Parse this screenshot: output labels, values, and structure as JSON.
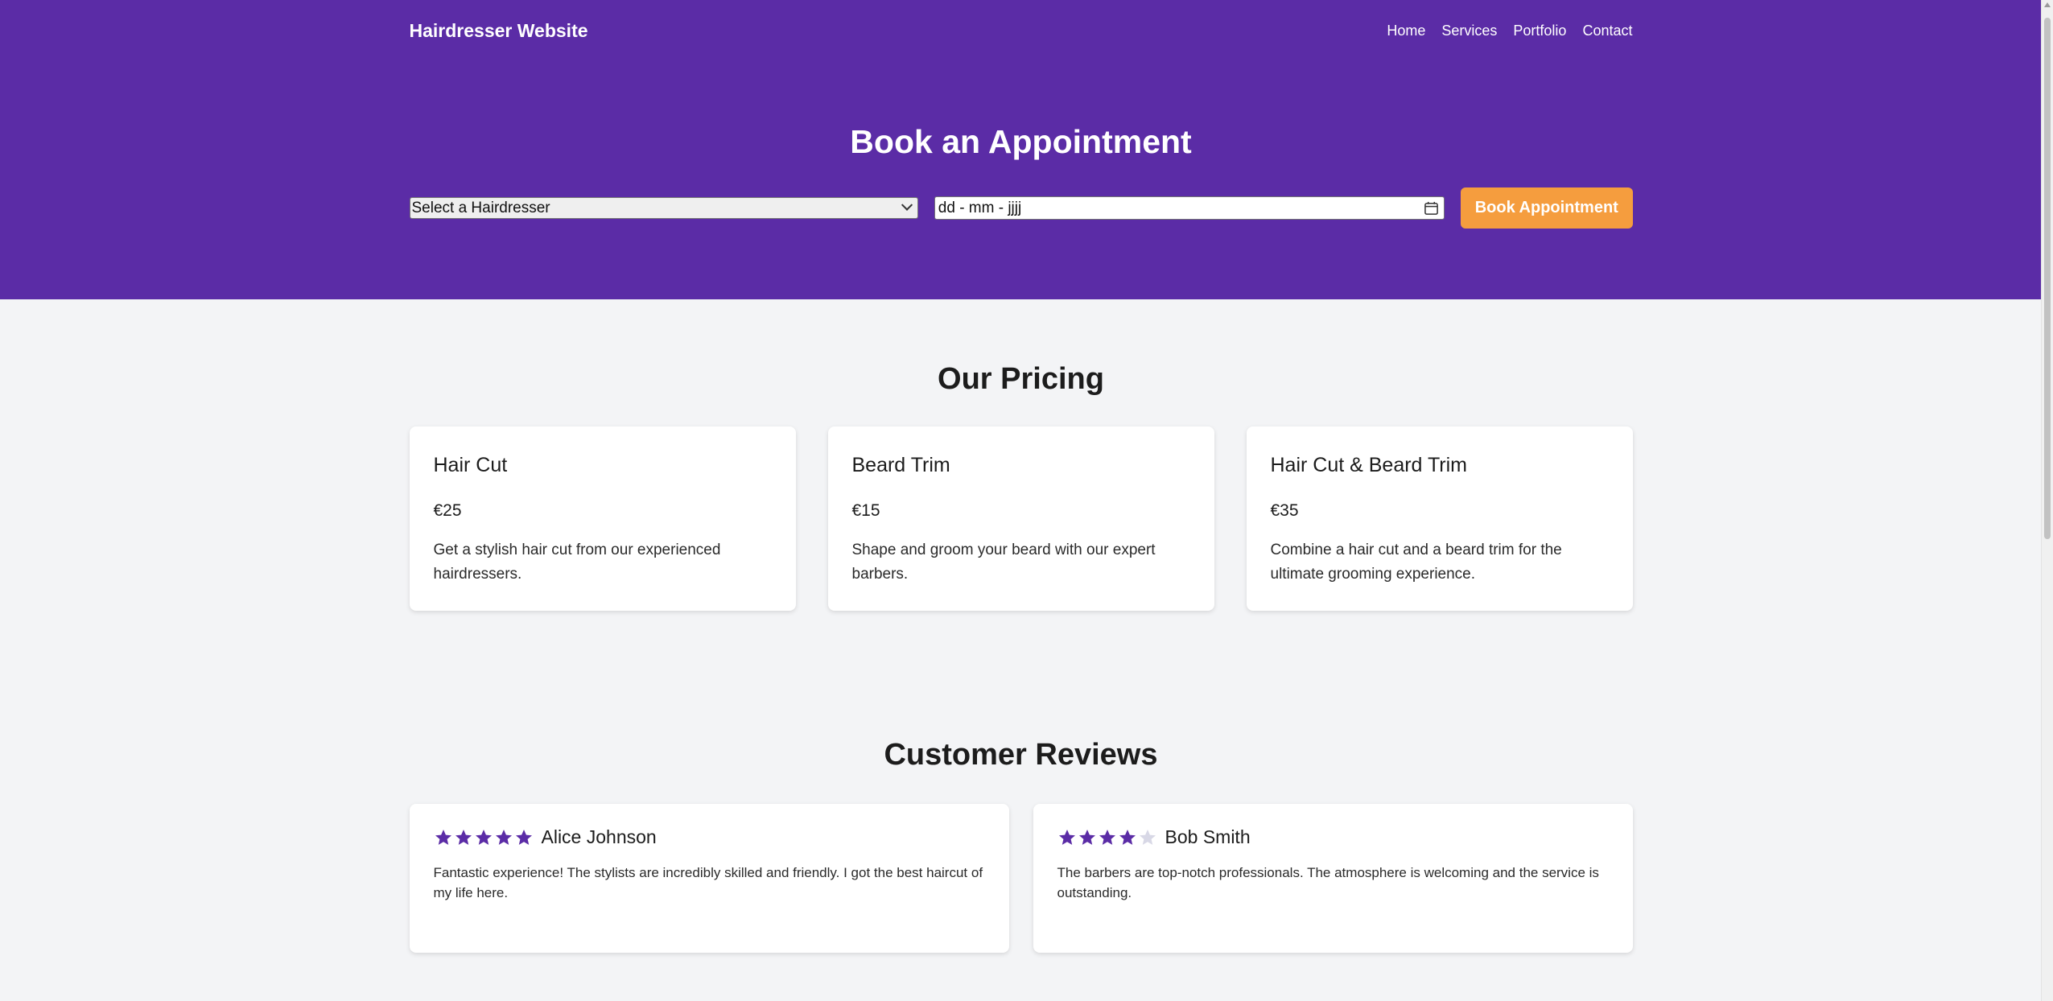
{
  "header": {
    "brand": "Hairdresser Website",
    "nav": [
      "Home",
      "Services",
      "Portfolio",
      "Contact"
    ]
  },
  "booking": {
    "title": "Book an Appointment",
    "hairdresser_select_value": "Select a Hairdresser",
    "date_placeholder": "dd - mm - jjjj",
    "book_button_label": "Book Appointment"
  },
  "pricing": {
    "title": "Our Pricing",
    "cards": [
      {
        "name": "Hair Cut",
        "price": "€25",
        "description": "Get a stylish hair cut from our experienced hairdressers."
      },
      {
        "name": "Beard Trim",
        "price": "€15",
        "description": "Shape and groom your beard with our expert barbers."
      },
      {
        "name": "Hair Cut & Beard Trim",
        "price": "€35",
        "description": "Combine a hair cut and a beard trim for the ultimate grooming experience."
      }
    ]
  },
  "reviews": {
    "title": "Customer Reviews",
    "items": [
      {
        "name": "Alice Johnson",
        "rating": 5,
        "max_rating": 5,
        "text": "Fantastic experience! The stylists are incredibly skilled and friendly. I got the best haircut of my life here."
      },
      {
        "name": "Bob Smith",
        "rating": 4,
        "max_rating": 5,
        "text": "The barbers are top-notch professionals. The atmosphere is welcoming and the service is outstanding."
      }
    ]
  },
  "colors": {
    "brand_purple": "#5b2ca6",
    "accent_orange": "#f59d3e",
    "star_filled": "#5b2ca6",
    "star_empty": "#d8d8e6"
  }
}
